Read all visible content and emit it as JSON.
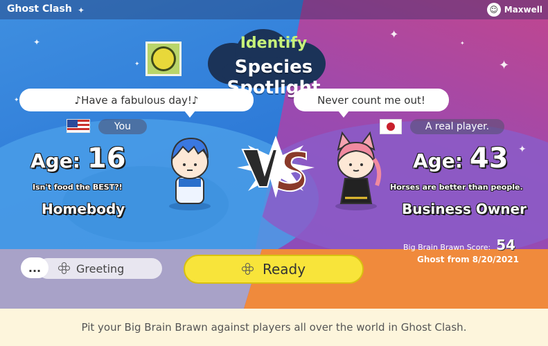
{
  "app": {
    "title": "Ghost Clash"
  },
  "user": {
    "name": "Maxwell",
    "avatar_icon": "avatar-icon"
  },
  "header": {
    "line1": "Identify",
    "line2": "Species Spotlight",
    "icon": "species-sun-icon"
  },
  "left_player": {
    "message": "♪Have a fabulous day!♪",
    "flag": "us-flag-icon",
    "name": "You",
    "age_label": "Age:",
    "age": "16",
    "quote": "Isn't food the BEST?!",
    "job": "Homebody"
  },
  "right_player": {
    "message": "Never count me out!",
    "flag": "japan-flag-icon",
    "name": "A real player.",
    "age_label": "Age:",
    "age": "43",
    "quote": "Horses are better than people.",
    "job": "Business Owner",
    "score_label": "Big Brain Brawn Score:",
    "score": "54",
    "ghost_date": "Ghost from 8/20/2021"
  },
  "actions": {
    "greeting_dots": "...",
    "greeting_label": "Greeting",
    "ready_label": "Ready"
  },
  "footer": {
    "caption": "Pit your Big Brain Brawn against players all over the world in Ghost Clash."
  },
  "colors": {
    "left_bg": "#2e7bd8",
    "right_bg": "#9a4ab0",
    "ready_button": "#f8e43a",
    "lower_right": "#f08a3c"
  }
}
